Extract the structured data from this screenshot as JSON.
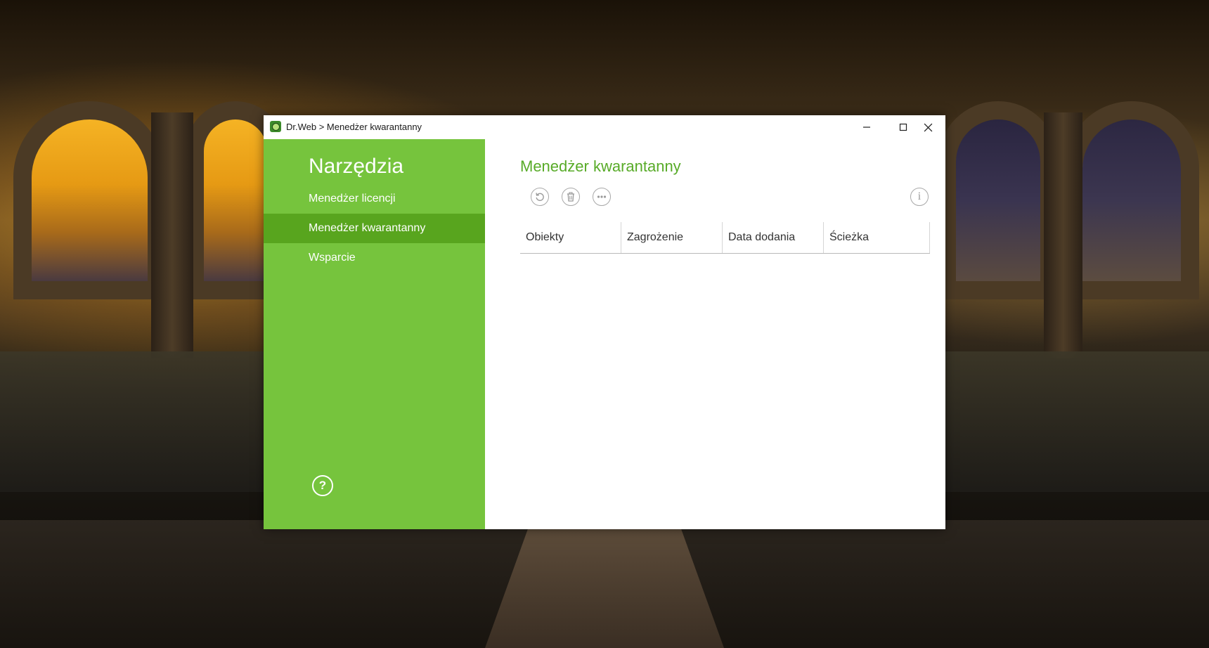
{
  "window": {
    "title": "Dr.Web > Menedżer kwarantanny",
    "controls": {
      "minimize": "minimize-icon",
      "maximize": "maximize-icon",
      "close": "close-icon"
    }
  },
  "sidebar": {
    "title": "Narzędzia",
    "items": [
      {
        "label": "Menedżer licencji",
        "active": false
      },
      {
        "label": "Menedżer kwarantanny",
        "active": true
      },
      {
        "label": "Wsparcie",
        "active": false
      }
    ],
    "help_icon": "help-icon",
    "help_glyph": "?"
  },
  "main": {
    "title": "Menedżer kwarantanny",
    "toolbar": [
      "restore-icon",
      "delete-icon",
      "more-icon"
    ],
    "info_glyph": "i",
    "table": {
      "columns": [
        "Obiekty",
        "Zagrożenie",
        "Data dodania",
        "Ścieżka"
      ],
      "rows": []
    }
  },
  "colors": {
    "sidebar": "#76c43d",
    "sidebar_active": "#58a51e",
    "accent_title": "#58ab28"
  }
}
